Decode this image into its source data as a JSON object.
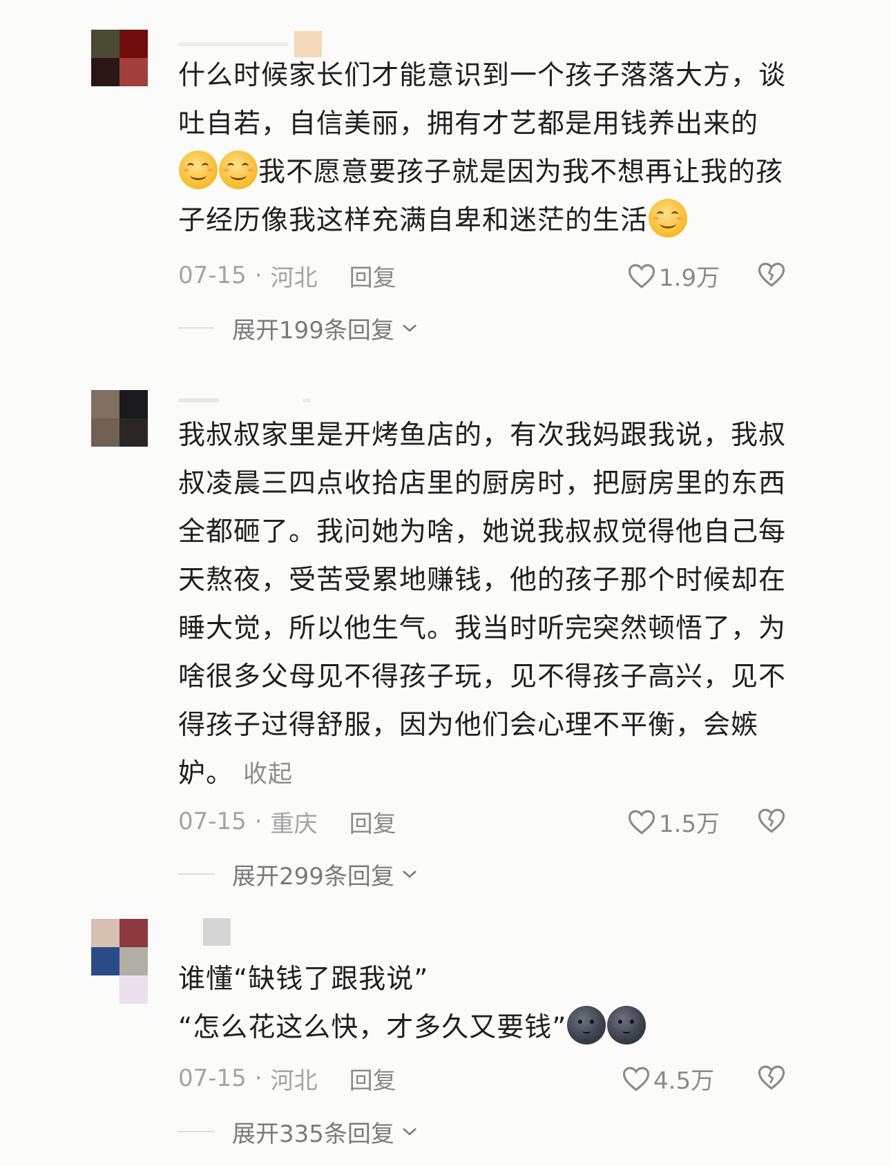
{
  "comments": [
    {
      "text_lines": [
        "什么时候家长们才能意识到一个孩子落落大方，谈",
        "吐自若，自信美丽，拥有才艺都是用钱养出来的",
        "我不愿意要孩子就是因为我不想再让我的孩",
        "子经历像我这样充满自卑和迷茫的生活"
      ],
      "date": "07-15",
      "separator": "·",
      "location": "河北",
      "reply_label": "回复",
      "likes": "1.9万",
      "expand_label": "展开199条回复",
      "avatar_colors": [
        "#4a4a33",
        "#6e0c0c",
        "#2a1714",
        "#a33f3c"
      ],
      "icons": {
        "like": "heart-outline-icon",
        "dislike": "broken-heart-icon",
        "expand": "chevron-down-icon",
        "emoji": "smiling-face-emoji"
      }
    },
    {
      "text_lines": [
        "我叔叔家里是开烤鱼店的，有次我妈跟我说，我叔",
        "叔凌晨三四点收拾店里的厨房时，把厨房里的东西",
        "全都砸了。我问她为啥，她说我叔叔觉得他自己每",
        "天熬夜，受苦受累地赚钱，他的孩子那个时候却在",
        "睡大觉，所以他生气。我当时听完突然顿悟了，为",
        "啥很多父母见不得孩子玩，见不得孩子高兴，见不",
        "得孩子过得舒服，因为他们会心理不平衡，会嫉",
        "妒。"
      ],
      "collapse_label": "收起",
      "date": "07-15",
      "separator": "·",
      "location": "重庆",
      "reply_label": "回复",
      "likes": "1.5万",
      "expand_label": "展开299条回复",
      "avatar_colors": [
        "#7f6f61",
        "#1b1b1d",
        "#6f6051",
        "#2b2624"
      ]
    },
    {
      "text_lines": [
        "谁懂“缺钱了跟我说”",
        "“怎么花这么快，才多久又要钱”"
      ],
      "date": "07-15",
      "separator": "·",
      "location": "河北",
      "reply_label": "回复",
      "likes": "4.5万",
      "expand_label": "展开335条回复",
      "avatar_colors": [
        "#d7c1b1",
        "#8c3a40",
        "#2b4b87",
        "#b1aea5",
        "#fbfbfa",
        "#ebe2ee"
      ],
      "icons": {
        "emoji": "new-moon-face-emoji"
      }
    }
  ]
}
